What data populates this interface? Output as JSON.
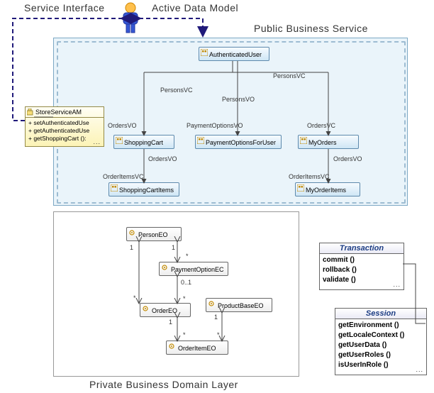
{
  "headings": {
    "service_interface": "Service Interface",
    "active_data_model": "Active Data Model",
    "public_business_service": "Public Business Service",
    "private_business_domain_layer": "Private Business Domain Layer"
  },
  "am": {
    "title": "StoreServiceAM",
    "ops": [
      "+ setAuthenticatedUse",
      "+ getAuthenticatedUse",
      "+ getShoppingCart ():"
    ]
  },
  "vo": {
    "authenticated_user": "AuthenticatedUser",
    "shopping_cart": "ShoppingCart",
    "payment_options_for_user": "PaymentOptionsForUser",
    "my_orders": "MyOrders",
    "shopping_cart_items": "ShoppingCartItems",
    "my_order_items": "MyOrderItems"
  },
  "eo": {
    "person": "PersonEO",
    "payment_option": "PaymentOptionEC",
    "order": "OrderEO",
    "product_base": "ProductBaseEO",
    "order_item": "OrderItemEO"
  },
  "txn": {
    "title": "Transaction",
    "ops": [
      "commit ()",
      "rollback ()",
      "validate ()"
    ]
  },
  "session": {
    "title": "Session",
    "ops": [
      "getEnvironment ()",
      "getLocaleContext ()",
      "getUserData ()",
      "getUserRoles ()",
      "isUserInRole ()"
    ]
  },
  "edge_labels": {
    "persons_vc_left": "PersonsVC",
    "persons_vo": "PersonsVO",
    "persons_vc_right": "PersonsVC",
    "orders_vo_left": "OrdersVO",
    "payment_options_vo": "PaymentOptionsVO",
    "orders_vc_right": "OrdersVC",
    "orders_vo_mid": "OrdersVO",
    "orders_vo_right2": "OrdersVO",
    "order_items_vc_left": "OrderItemsVC",
    "order_items_vc_right": "OrderItemsVC"
  },
  "mult": {
    "one": "1",
    "star": "*",
    "zero_one": "0..1"
  },
  "chart_data": {
    "type": "table",
    "description": "UML-style architecture diagram",
    "actor": "User",
    "service_interface": {
      "class": "StoreServiceAM",
      "operations": [
        "setAuthenticatedUser",
        "getAuthenticatedUser",
        "getShoppingCart"
      ]
    },
    "public_business_service_view_objects": [
      {
        "name": "AuthenticatedUser",
        "links": [
          {
            "to": "ShoppingCart",
            "via": "PersonsVC"
          },
          {
            "to": "PaymentOptionsForUser",
            "via": "PersonsVO"
          },
          {
            "to": "MyOrders",
            "via": "PersonsVC"
          }
        ]
      },
      {
        "name": "ShoppingCart",
        "incoming": "OrdersVO",
        "links": [
          {
            "to": "ShoppingCartItems",
            "via": "OrdersVO / OrderItemsVC"
          }
        ]
      },
      {
        "name": "PaymentOptionsForUser",
        "incoming": "PaymentOptionsVO"
      },
      {
        "name": "MyOrders",
        "incoming": "OrdersVC",
        "links": [
          {
            "to": "MyOrderItems",
            "via": "OrdersVO / OrderItemsVC"
          }
        ]
      },
      {
        "name": "ShoppingCartItems"
      },
      {
        "name": "MyOrderItems"
      }
    ],
    "private_business_domain_entities": [
      {
        "name": "PersonEO",
        "assoc": [
          {
            "to": "PaymentOptionEC",
            "a": "1",
            "b": "*"
          },
          {
            "to": "OrderEO",
            "a": "1",
            "b": "*"
          }
        ]
      },
      {
        "name": "PaymentOptionEC",
        "assoc": [
          {
            "to": "OrderEO",
            "a": "0..1",
            "b": "*"
          }
        ]
      },
      {
        "name": "OrderEO",
        "assoc": [
          {
            "to": "OrderItemEO",
            "a": "1",
            "b": "*"
          }
        ]
      },
      {
        "name": "ProductBaseEO",
        "assoc": [
          {
            "to": "OrderItemEO",
            "a": "1",
            "b": "*"
          }
        ]
      },
      {
        "name": "OrderItemEO"
      }
    ],
    "framework_classes": [
      {
        "name": "Transaction",
        "ops": [
          "commit()",
          "rollback()",
          "validate()"
        ]
      },
      {
        "name": "Session",
        "ops": [
          "getEnvironment()",
          "getLocaleContext()",
          "getUserData()",
          "getUserRoles()",
          "isUserInRole()"
        ]
      }
    ],
    "framework_relation": "Transaction 1—1 Session (via StoreServiceAM)"
  }
}
